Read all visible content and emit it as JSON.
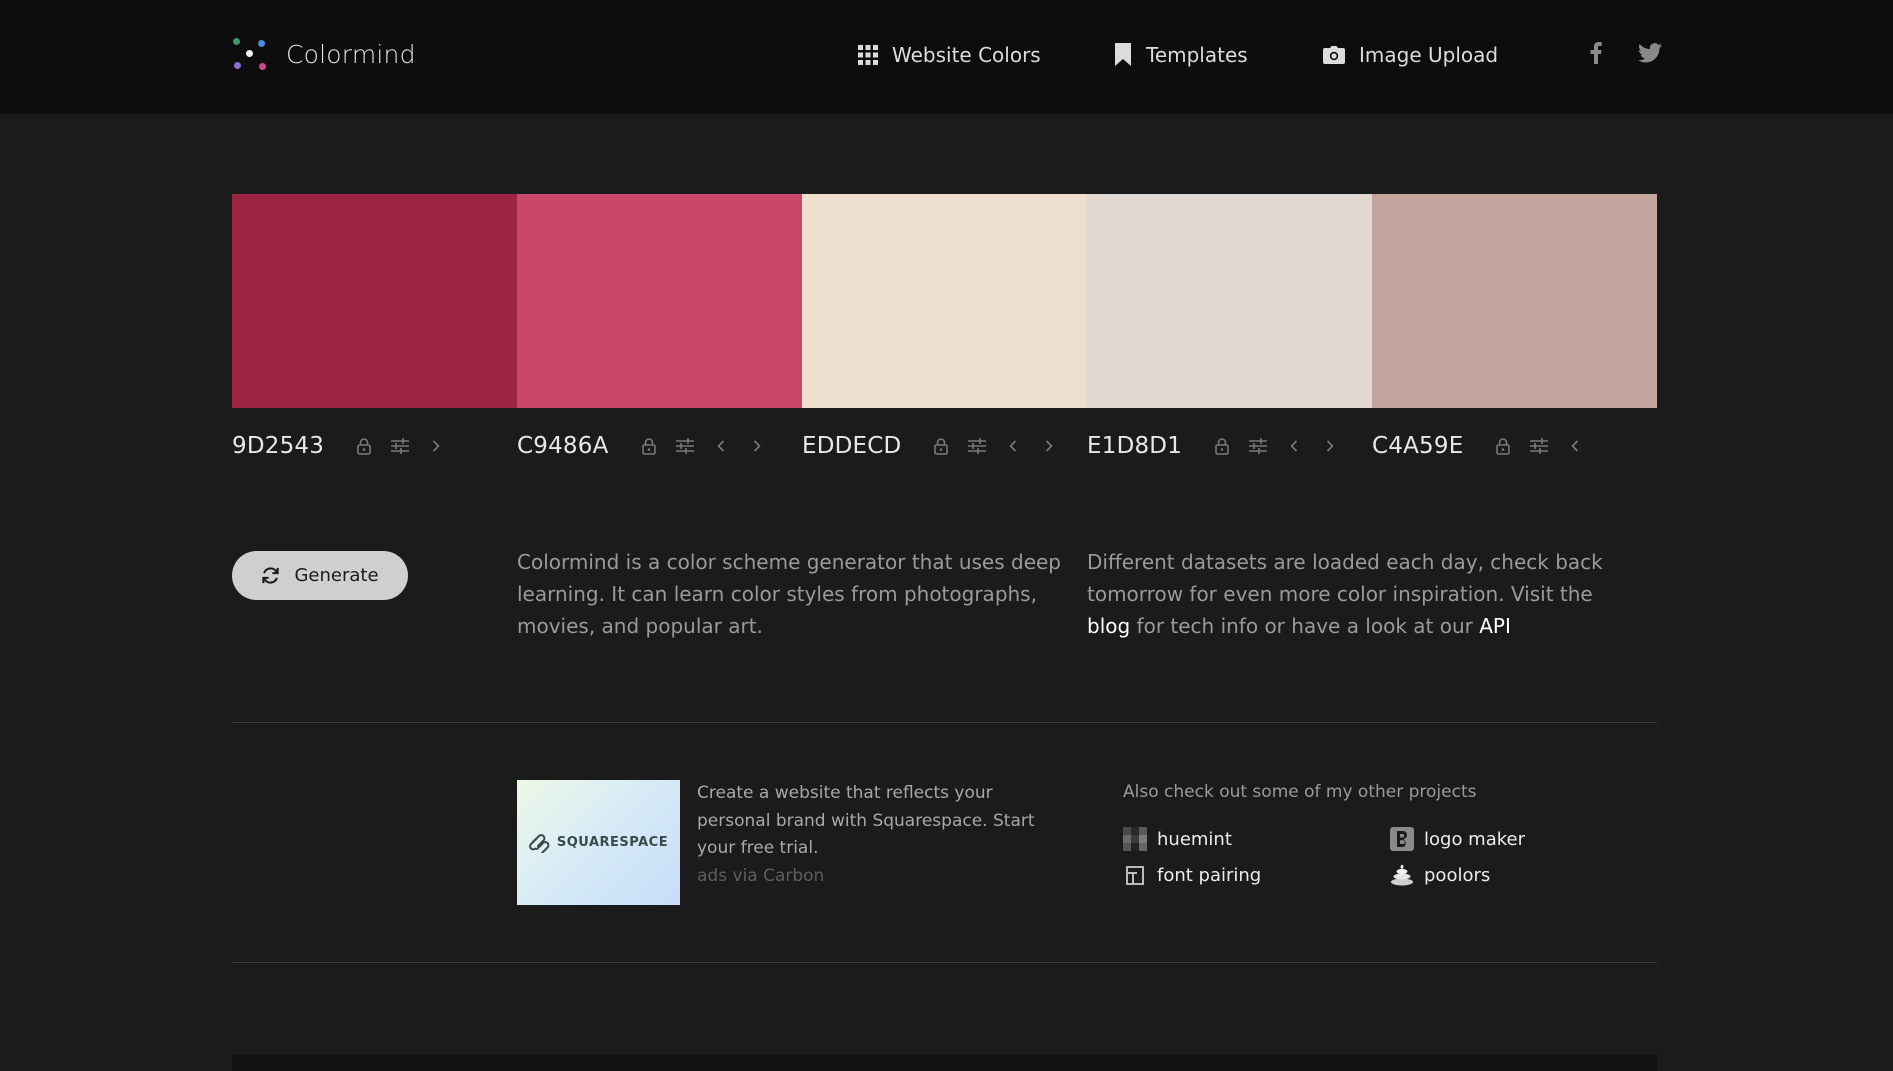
{
  "header": {
    "brand_name": "Colormind",
    "nav": [
      {
        "label": "Website Colors",
        "icon": "grid-icon"
      },
      {
        "label": "Templates",
        "icon": "bookmark-icon"
      },
      {
        "label": "Image Upload",
        "icon": "camera-icon"
      }
    ],
    "social": [
      {
        "icon": "facebook-icon"
      },
      {
        "icon": "twitter-icon"
      }
    ]
  },
  "palette": {
    "colors": [
      {
        "hex": "9D2543",
        "color": "#9D2543",
        "controls": [
          "lock",
          "adjust",
          "right"
        ]
      },
      {
        "hex": "C9486A",
        "color": "#C9486A",
        "controls": [
          "lock",
          "adjust",
          "left",
          "right"
        ]
      },
      {
        "hex": "EDDECD",
        "color": "#EDDECD",
        "controls": [
          "lock",
          "adjust",
          "left",
          "right"
        ]
      },
      {
        "hex": "E1D8D1",
        "color": "#E1D8D1",
        "controls": [
          "lock",
          "adjust",
          "left",
          "right"
        ]
      },
      {
        "hex": "C4A59E",
        "color": "#C4A59E",
        "controls": [
          "lock",
          "adjust",
          "left"
        ]
      }
    ]
  },
  "generate": {
    "label": "Generate",
    "icon": "refresh-icon"
  },
  "about": {
    "line1": "Colormind is a color scheme generator that uses deep",
    "line2": "learning. It can learn color styles from photographs,",
    "line3": "movies, and popular art."
  },
  "info": {
    "line1": "Different datasets are loaded each day, check back",
    "line2": "tomorrow for even more color inspiration. Visit the",
    "blog_link": "blog",
    "middle": " for tech info or have a look at our ",
    "api_link": "API"
  },
  "ad": {
    "brand_text": "SQUARESPACE",
    "body": "Create a website that reflects your personal brand with Squarespace. Start your free trial.",
    "via": "ads via Carbon"
  },
  "projects": {
    "title": "Also check out some of my other projects",
    "items": [
      {
        "label": "huemint",
        "icon": "huemint-icon"
      },
      {
        "label": "logo maker",
        "icon": "logo-maker-icon"
      },
      {
        "label": "font pairing",
        "icon": "font-pairing-icon"
      },
      {
        "label": "poolors",
        "icon": "poolors-icon"
      }
    ]
  },
  "colors": {
    "topbar": "#0d0d0d",
    "page": "#1b1b1b",
    "generate_button": "#cfcfcf"
  }
}
